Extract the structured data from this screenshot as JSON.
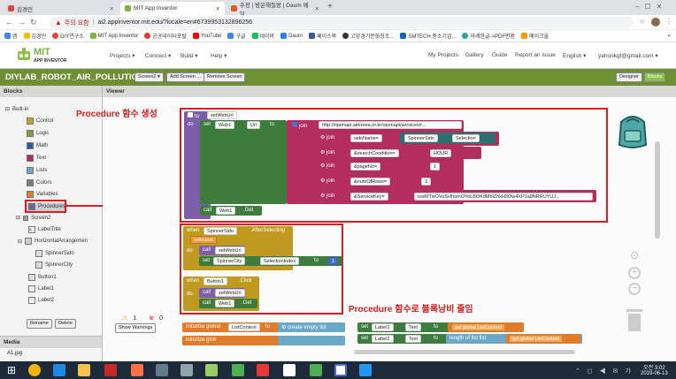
{
  "browser": {
    "tabs": [
      {
        "title": "김경민",
        "active": false
      },
      {
        "title": "MIT App Inventor",
        "active": true
      },
      {
        "title": "수정 | 방은해질랑 | Daum 메일",
        "active": false
      }
    ],
    "new_tab": "+",
    "url_warning": "주의 요함",
    "url": "ai2.appinventor.mit.edu/?locale=en#6739953132896256",
    "bookmarks": [
      "앱",
      "김경민",
      "DIY연구소",
      "MIT App Inventor",
      "공공데이터포털",
      "YouTube",
      "구글",
      "네이버",
      "Daum",
      "페이스북",
      "고양경기문화창조...",
      "SMTECH 중소기업...",
      "아래한글->PDF변환",
      "메이크올"
    ],
    "bookmarks_more": "»"
  },
  "app": {
    "logo_line1": "MIT",
    "logo_line2": "APP INVENTOR",
    "menus": [
      "Projects ▾",
      "Connect ▾",
      "Build ▾",
      "Help ▾"
    ],
    "right_menus": [
      "My Projects",
      "Gallery",
      "Guide",
      "Report an Issue",
      "English ▾",
      "yahookgt@gmail.com ▾"
    ],
    "project_title": "DIYLAB_ROBOT_AIR_POLLUTION1",
    "project_buttons": [
      "Screen2 ▾",
      "Add Screen ...",
      "Remove Screen"
    ],
    "mode_buttons": [
      "Designer",
      "Blocks"
    ]
  },
  "blocks_panel": {
    "header": "Blocks",
    "builtin": "Built-in",
    "builtin_items": [
      {
        "label": "Control",
        "color": "#c8a32a"
      },
      {
        "label": "Logic",
        "color": "#7aa23a"
      },
      {
        "label": "Math",
        "color": "#2b5ba8"
      },
      {
        "label": "Text",
        "color": "#b32d5e"
      },
      {
        "label": "Lists",
        "color": "#6aa8c8"
      },
      {
        "label": "Colors",
        "color": "#7d7d7d"
      },
      {
        "label": "Variables",
        "color": "#e07b2a"
      },
      {
        "label": "Procedures",
        "color": "#7b5ea7"
      }
    ],
    "screen": "Screen2",
    "components": [
      "LabelTitle",
      "HorizontalArrangemen",
      "SpinnerSido",
      "SpinnerCity",
      "Button1",
      "Label1",
      "Label2"
    ],
    "rename": "Rename",
    "delete": "Delete",
    "media_header": "Media",
    "media_item": "A1.jpg"
  },
  "viewer": {
    "header": "Viewer",
    "warnings_count": "1",
    "errors_count": "0",
    "show_warnings": "Show Warnings"
  },
  "annotations": {
    "procedure_create": "Procedure 함수 생성",
    "procedure_saving": "Procedure 함수로 블록낭비 줄임"
  },
  "code": {
    "proc_to": "to",
    "proc_name": "setWebUrl",
    "do": "do",
    "set": "set",
    "web1": "Web1",
    "url_prop": "Url",
    "to_kw": "to",
    "join": "join",
    "base_url": "http://openapi.airkorea.or.kr/openapi/services/r...",
    "sido_param": "sidoName=",
    "spinner_sido": "SpinnerSido",
    "selection": "Selection",
    "search_cond_param": "&searchCondition=",
    "search_cond_val": "HOUR",
    "pageno_param": "&pageNo=",
    "pageno_val": "1",
    "numrows_param": "&numOfRows=",
    "numrows_val": "3",
    "servicekey_param": "&ServiceKey=",
    "servicekey_val": "izwMTwOVuSvlhomOYoLBOKdMblZnkH3Ow4XP1a9NRRUYUJ...",
    "call": "call",
    "get": "Get",
    "event1_when": "when",
    "event1_comp": "SpinnerSido",
    "event1_name": ".AfterSelecting",
    "event1_param": "selection",
    "spinner_city": "SpinnerCity",
    "selection_index": "SelectionIndex",
    "selection_index_val": "1",
    "event2_comp": "Button1",
    "event2_name": ".Click",
    "init_global": "initialize global",
    "list_content": "ListContent",
    "create_empty_list": "create empty list",
    "init_global2": "initialize glob",
    "label1": "Label1",
    "label2": "Label2",
    "text_prop": "Text",
    "get_list_content": "get global ListContent",
    "length_of_list": "length of list  list",
    "get_kw": "get"
  },
  "taskbar": {
    "time": "오전 3:02",
    "date": "2019-06-13"
  }
}
